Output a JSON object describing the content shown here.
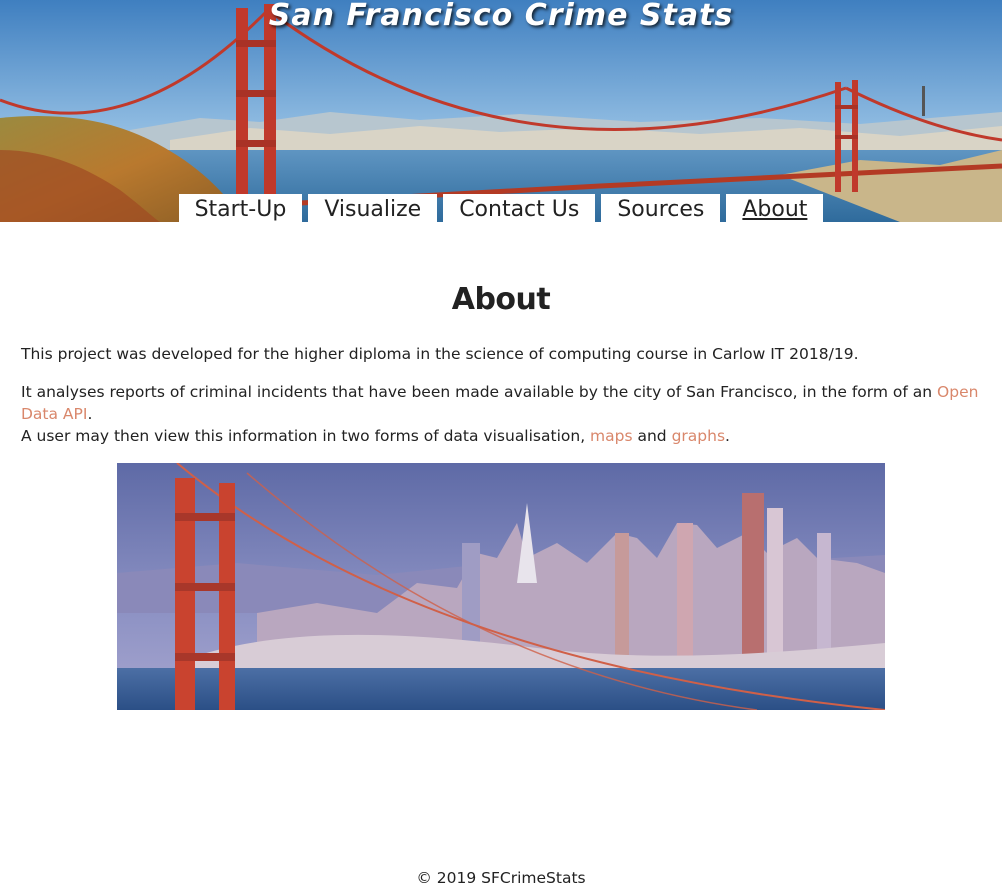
{
  "site": {
    "title": "San Francisco Crime Stats"
  },
  "nav": {
    "items": [
      {
        "label": "Start-Up"
      },
      {
        "label": "Visualize"
      },
      {
        "label": "Contact Us"
      },
      {
        "label": "Sources"
      },
      {
        "label": "About"
      }
    ],
    "active": "About"
  },
  "main": {
    "heading": "About",
    "p1": "This project was developed for the higher diploma in the science of computing course in Carlow IT 2018/19.",
    "p2_text": "It analyses reports of criminal incidents that have been made available by the city of San Francisco, in the form of an ",
    "p2_link": "Open Data API",
    "p2_end": ".",
    "p3_text": "A user may then view this information in two forms of data visualisation, ",
    "p3_link1": "maps",
    "p3_and": " and ",
    "p3_link2": "graphs",
    "p3_end": "."
  },
  "footer": {
    "text": "© 2019 SFCrimeStats"
  },
  "colors": {
    "link": "#d9876b",
    "bridge": "#c0392b",
    "sky": "#6fa4d0"
  }
}
